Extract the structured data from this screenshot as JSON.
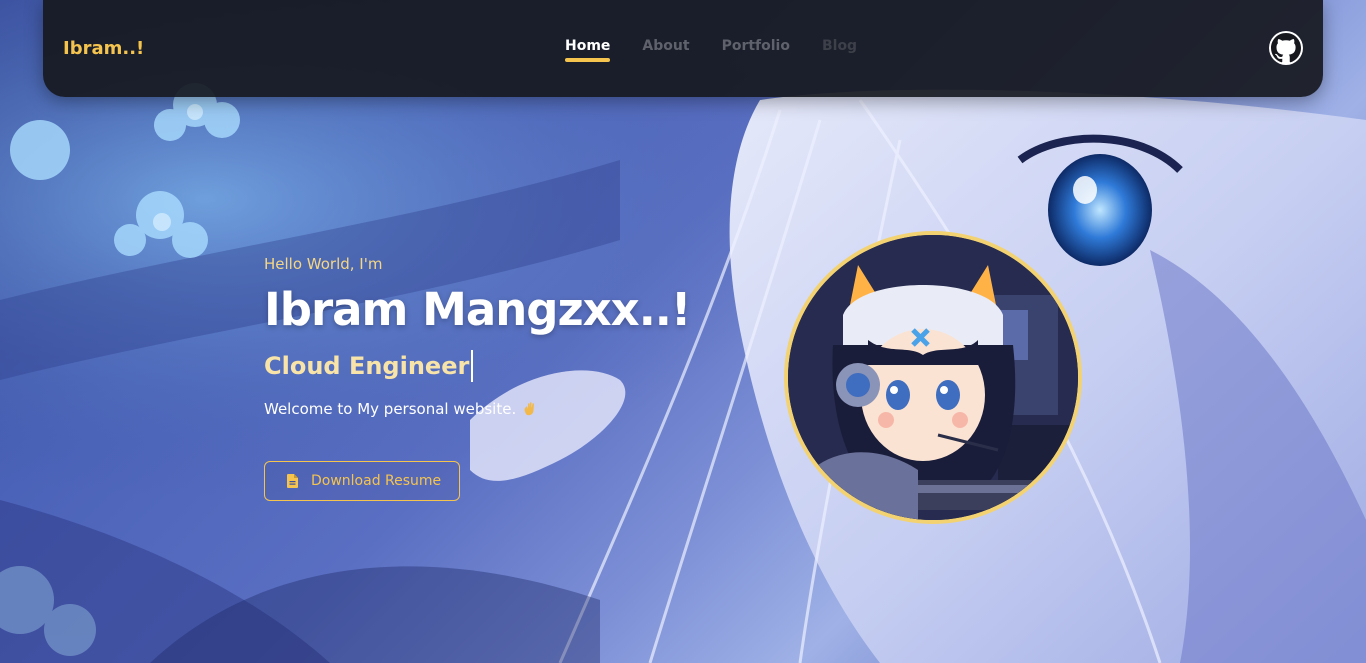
{
  "navbar": {
    "brand": "Ibram..!",
    "links": [
      {
        "label": "Home",
        "active": true
      },
      {
        "label": "About",
        "active": false
      },
      {
        "label": "Portfolio",
        "active": false
      },
      {
        "label": "Blog",
        "active": false
      }
    ],
    "github_icon": "github-icon"
  },
  "hero": {
    "greeting": "Hello World, I'm",
    "name": "Ibram Mangzxx..!",
    "role": "Cloud Engineer",
    "welcome": "Welcome to My personal website.",
    "wave_icon": "waving-hand-icon"
  },
  "resume_button": {
    "label": "Download Resume",
    "icon": "file-icon"
  },
  "colors": {
    "accent": "#f5c44f",
    "nav_bg": "#16181e",
    "text": "#ffffff"
  }
}
